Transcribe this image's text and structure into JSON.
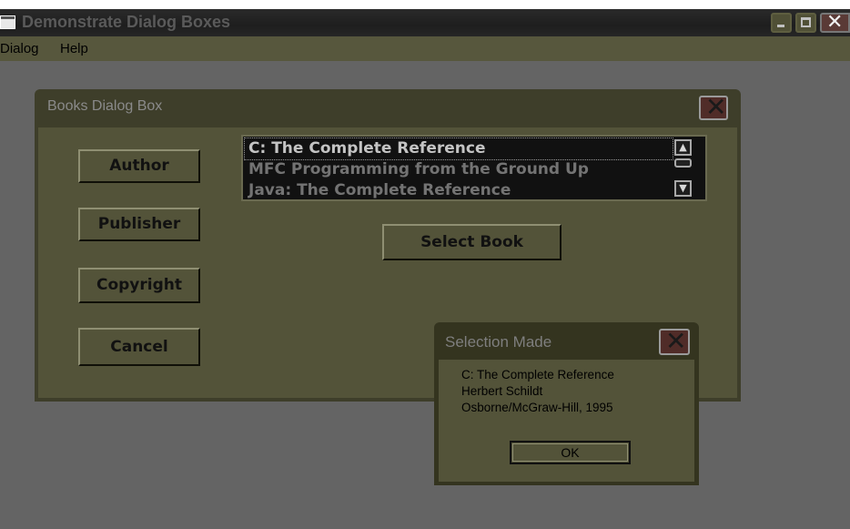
{
  "window": {
    "title": "Demonstrate Dialog Boxes"
  },
  "menubar": {
    "items": [
      "Dialog",
      "Help"
    ]
  },
  "books_dialog": {
    "title": "Books Dialog Box",
    "buttons": {
      "author": "Author",
      "publisher": "Publisher",
      "copyright": "Copyright",
      "cancel": "Cancel",
      "select_book": "Select Book"
    },
    "listbox": {
      "items": [
        "C: The Complete Reference",
        "MFC Programming from the Ground Up",
        "Java: The Complete Reference"
      ],
      "selected_index": 0
    }
  },
  "selection_dialog": {
    "title": "Selection Made",
    "message_lines": [
      "C: The Complete Reference",
      "Herbert Schildt",
      "Osborne/McGraw-Hill, 1995"
    ],
    "ok_label": "OK"
  },
  "icons": {
    "app": "app-window-icon",
    "minimize": "minimize-icon",
    "maximize": "maximize-icon",
    "close": "close-icon",
    "scroll_up": "chevron-up-icon",
    "scroll_down": "chevron-down-icon"
  }
}
